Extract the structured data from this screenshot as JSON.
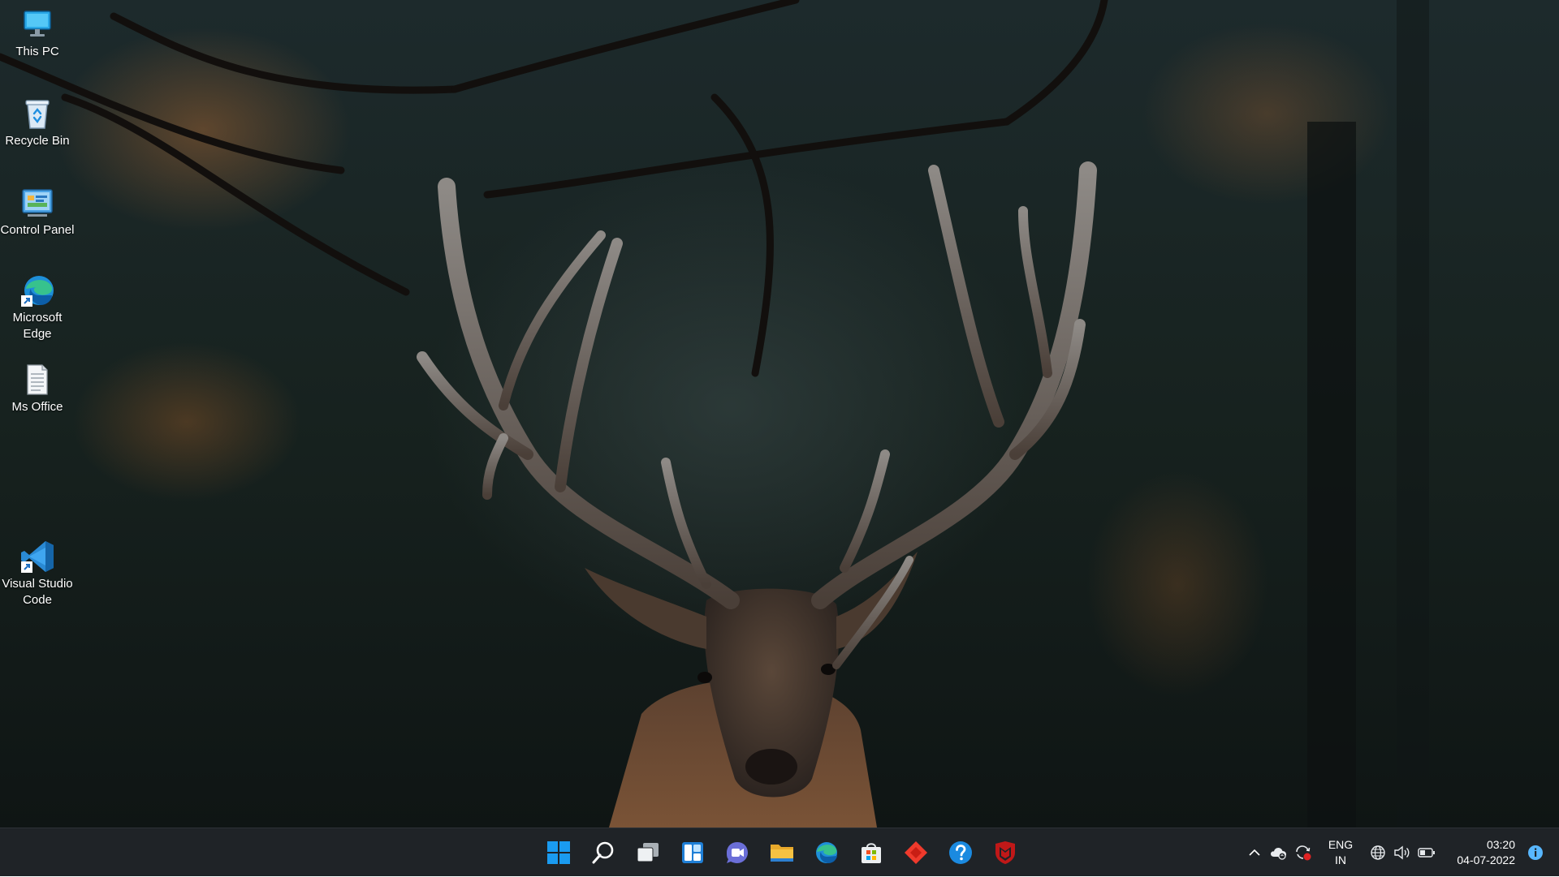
{
  "desktop": {
    "icons": [
      {
        "label": "This PC",
        "icon": "this-pc-icon"
      },
      {
        "label": "Recycle Bin",
        "icon": "recycle-bin-icon"
      },
      {
        "label": "Control Panel",
        "icon": "control-panel-icon"
      },
      {
        "label": "Microsoft Edge",
        "icon": "edge-shortcut-icon"
      },
      {
        "label": "Ms Office",
        "icon": "text-document-icon"
      },
      {
        "label": "Visual Studio Code",
        "icon": "vscode-shortcut-icon"
      }
    ]
  },
  "taskbar": {
    "pinned": [
      {
        "name": "start",
        "icon": "windows-logo-icon"
      },
      {
        "name": "search",
        "icon": "search-icon"
      },
      {
        "name": "task-view",
        "icon": "task-view-icon"
      },
      {
        "name": "widgets",
        "icon": "widgets-icon"
      },
      {
        "name": "teams-chat",
        "icon": "chat-camera-icon"
      },
      {
        "name": "file-explorer",
        "icon": "folder-icon"
      },
      {
        "name": "edge",
        "icon": "edge-icon"
      },
      {
        "name": "store",
        "icon": "store-icon"
      },
      {
        "name": "anydesk",
        "icon": "red-diamond-icon"
      },
      {
        "name": "get-help",
        "icon": "help-icon"
      },
      {
        "name": "mcafee",
        "icon": "mcafee-shield-icon"
      }
    ],
    "tray": {
      "language_line1": "ENG",
      "language_line2": "IN",
      "time": "03:20",
      "date": "04-07-2022"
    }
  },
  "colors": {
    "taskbar_bg": "#1f2327",
    "accent_blue": "#0f7ad8",
    "edge_teal": "#2fbf9b",
    "store_red": "#f25022",
    "mcafee_red": "#c01818",
    "folder_yellow": "#f5c242"
  }
}
